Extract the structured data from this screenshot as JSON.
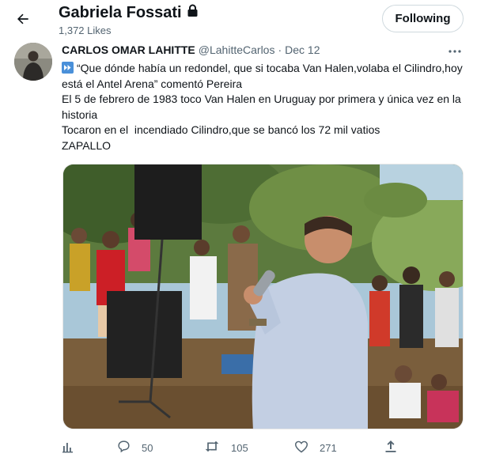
{
  "header": {
    "profile_name": "Gabriela Fossati",
    "likes_count": "1,372 Likes",
    "follow_button": "Following"
  },
  "tweet": {
    "author_name": "CARLOS OMAR LAHITTE",
    "author_handle": "@LahitteCarlos",
    "separator": "·",
    "date": "Dec 12",
    "text_lines": [
      "“Que dónde había un redondel, que si tocaba Van Halen,volaba el Cilindro,hoy está el Antel Arena” comentó Pereira",
      "El 5 de febrero de 1983 toco Van Halen en Uruguay por primera y única vez en la historia",
      "Tocaron en el  incendiado Cilindro,que se bancó los 72 mil vatios",
      "ZAPALLO"
    ],
    "actions": {
      "replies": "50",
      "retweets": "105",
      "likes": "271"
    }
  },
  "icons": {
    "back": "arrow-left-icon",
    "lock": "lock-icon",
    "more": "more-horizontal-icon",
    "fast_forward": "fast-forward-icon",
    "analytics": "analytics-icon",
    "reply": "reply-icon",
    "retweet": "retweet-icon",
    "like": "heart-icon",
    "share": "share-icon"
  },
  "colors": {
    "text_primary": "#0f1419",
    "text_secondary": "#536471",
    "border": "#cfd9de",
    "emoji_blue": "#4a90d9"
  }
}
